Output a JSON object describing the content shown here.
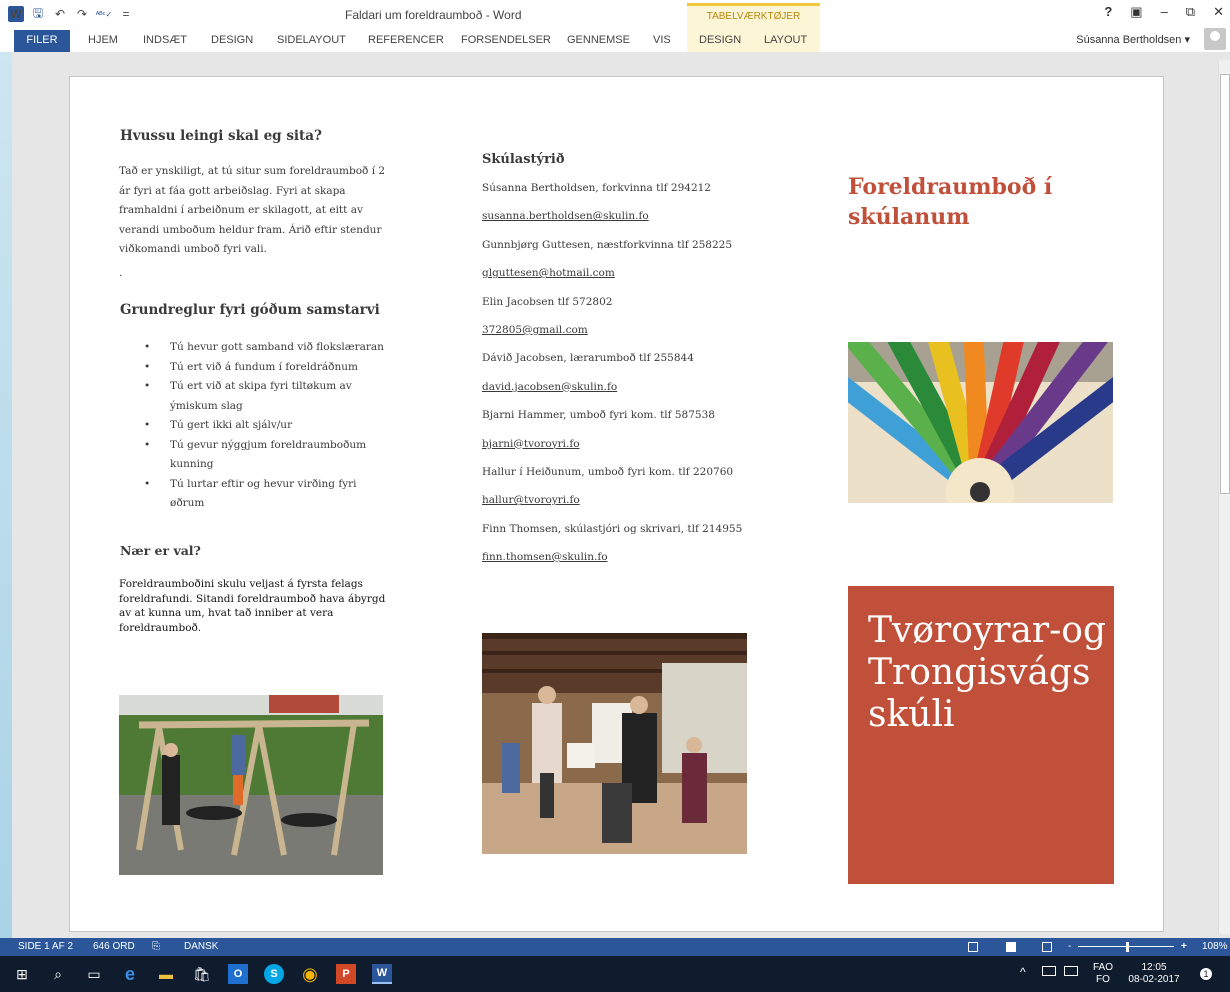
{
  "titlebar": {
    "title": "Faldari um foreldraumboð - Word",
    "context_group": "TABELVÆRKTØJER",
    "help": "?",
    "ribbon_display": "▣",
    "minimize": "–",
    "restore": "⧉",
    "close": "✕",
    "qat": {
      "word": "W",
      "save": "🖫",
      "undo": "↶",
      "redo": "↷",
      "spelling": "ᴬᴮᶜ✓",
      "more": "="
    }
  },
  "ribbon": {
    "tabs": [
      "FILER",
      "HJEM",
      "INDSÆT",
      "DESIGN",
      "SIDELAYOUT",
      "REFERENCER",
      "FORSENDELSER",
      "GENNEMSE",
      "VIS",
      "DESIGN",
      "LAYOUT"
    ],
    "user": "Súsanna Bertholdsen ▾"
  },
  "doc": {
    "col1": {
      "heading1": "Hvussu leingi skal eg sita?",
      "para1": "Tað er ynskiligt, at tú situr sum foreldraumboð í 2 ár fyri at fáa gott arbeiðslag. Fyri at skapa framhaldni í arbeiðnum er skilagott, at eitt av verandi umboðum heldur fram. Árið eftir stendur viðkomandi umboð fyri vali.",
      "dot": ".",
      "heading2": "Grundreglur fyri góðum samstarvi",
      "bullets": [
        "Tú hevur gott samband við flokslæraran",
        "Tú ert við á fundum í foreldráðnum",
        "Tú ert við at skipa fyri tiltøkum av ýmiskum slag",
        "Tú gert ikki alt sjálv/ur",
        "Tú gevur nýggjum foreldraumboðum kunning",
        "Tú lurtar eftir og hevur virðing fyri øðrum"
      ],
      "heading3": "Nær er val?",
      "para2": "Foreldraumboðini skulu veljast á fyrsta felags foreldrafundi. Sitandi foreldraumboð hava ábyrgd av at kunna um, hvat tað inniber at vera foreldraumboð."
    },
    "col2": {
      "heading": "Skúlastýrið",
      "lines": [
        "Súsanna Bertholdsen, forkvinna tlf 294212",
        "susanna.bertholdsen@skulin.fo",
        "Gunnbjørg Guttesen, næstforkvinna tlf 258225",
        "glguttesen@hotmail.com",
        "Elin Jacobsen tlf 572802",
        "372805@gmail.com",
        "Dávið Jacobsen, lærarumboð tlf 255844",
        "david.jacobsen@skulin.fo",
        "Bjarni Hammer, umboð fyri kom. tlf 587538",
        "bjarni@tvoroyri.fo",
        "Hallur í Heiðunum, umboð fyri kom. tlf 220760",
        "hallur@tvoroyri.fo",
        "Finn Thomsen, skúlastjóri og skrivari, tlf 214955",
        "finn.thomsen@skulin.fo"
      ]
    },
    "col3": {
      "cover_title": "Foreldraumboð í skúlanum",
      "school_name": "Tvøroyrar-og Trongisvágs skúli"
    }
  },
  "statusbar": {
    "page": "SIDE 1 AF 2",
    "words": "646 ORD",
    "lang_icon": "⎘",
    "language": "DANSK",
    "zoom_minus": "-",
    "zoom_plus": "+",
    "zoom": "108%"
  },
  "taskbar": {
    "lang1": "FAO",
    "lang2": "FO",
    "time": "12:05",
    "date": "08-02-2017",
    "notif_count": "1",
    "tray_chevron": "^",
    "icons": {
      "start": "⊞",
      "search": "⌕",
      "taskview": "▭",
      "edge": "e",
      "explorer": "▬",
      "store": "🛍",
      "outlook": "O",
      "skype": "S",
      "chrome": "◉",
      "powerpoint": "P",
      "word": "W"
    }
  },
  "colors": {
    "word_blue": "#2b579a",
    "accent_red": "#c0503a",
    "context_yellow": "#fdf6d6"
  }
}
